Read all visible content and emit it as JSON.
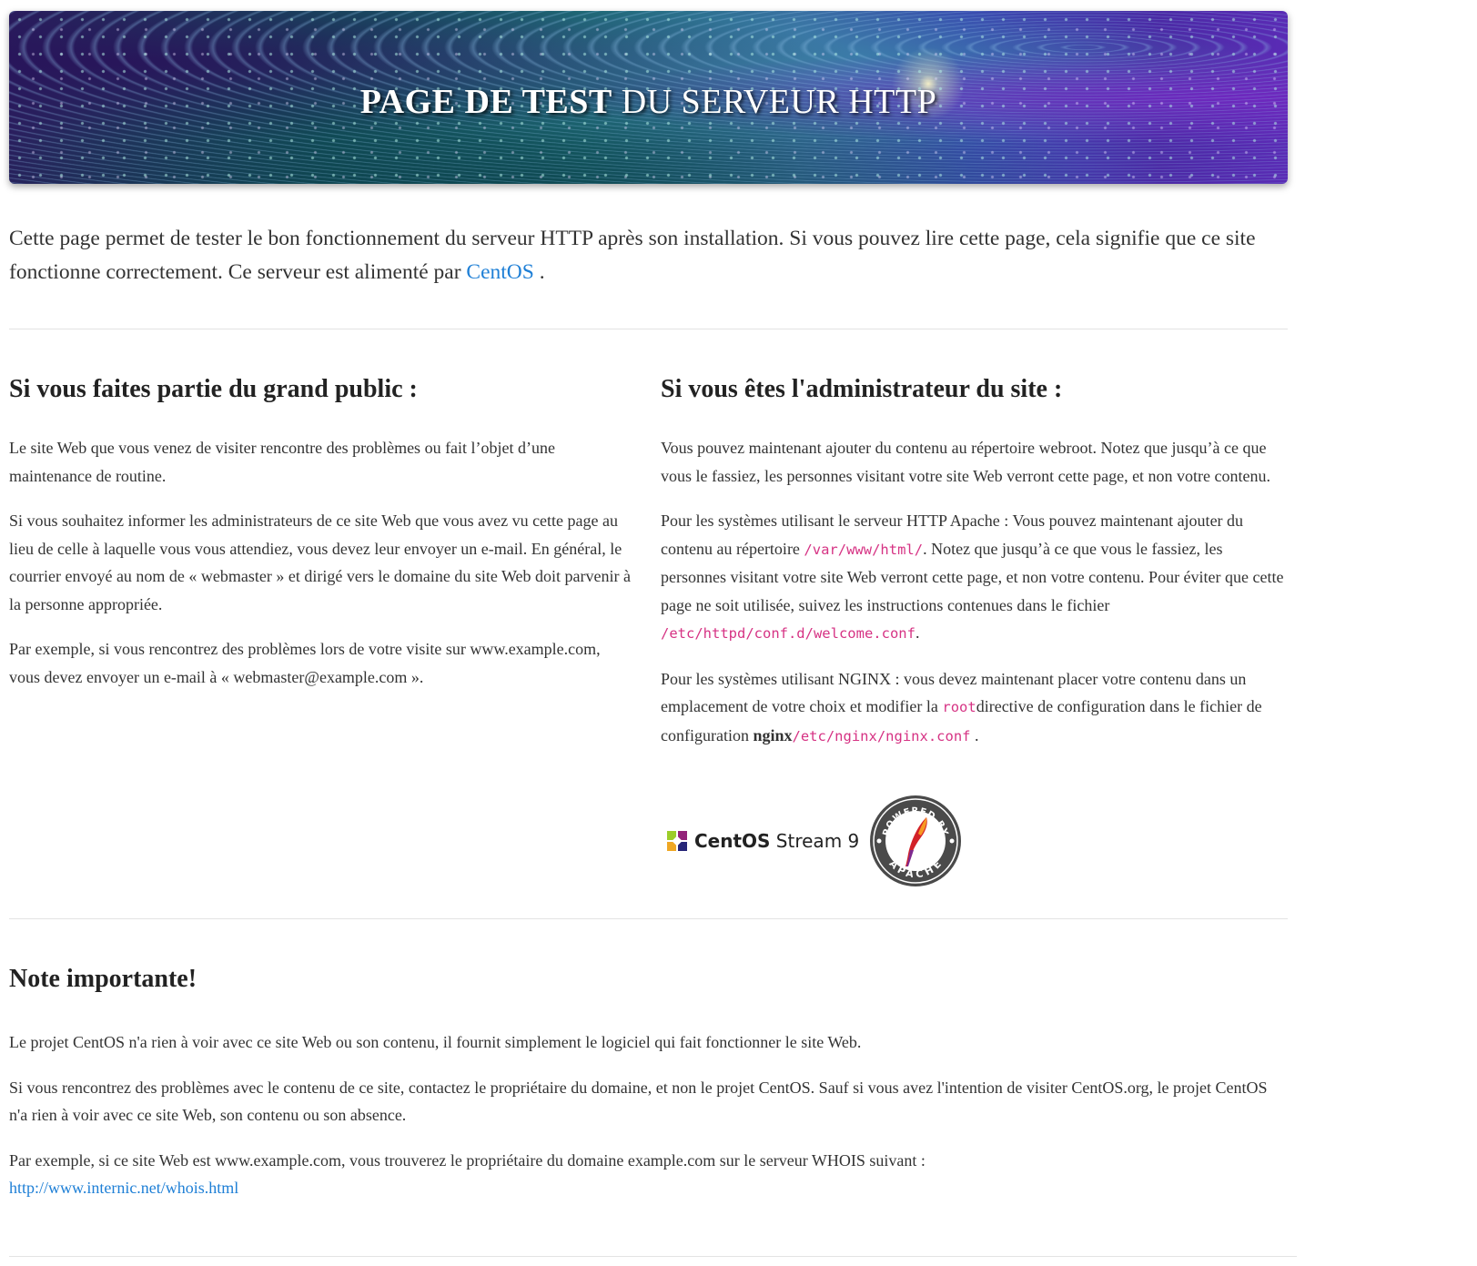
{
  "banner": {
    "title_bold": "PAGE DE TEST",
    "title_rest": "DU SERVEUR HTTP"
  },
  "intro": {
    "text": "Cette page permet de tester le bon fonctionnement du serveur HTTP après son installation. Si vous pouvez lire cette page, cela signifie que ce site fonctionne correctement. Ce serveur est alimenté par",
    "link": "CentOS",
    "after": " ."
  },
  "public": {
    "heading": "Si vous faites partie du grand public :",
    "p1": "Le site Web que vous venez de visiter rencontre des problèmes ou fait l’objet d’une maintenance de routine.",
    "p2": "Si vous souhaitez informer les administrateurs de ce site Web que vous avez vu cette page au lieu de celle à laquelle vous vous attendiez, vous devez leur envoyer un e-mail. En général, le courrier envoyé au nom de « webmaster » et dirigé vers le domaine du site Web doit parvenir à la personne appropriée.",
    "p3": "Par exemple, si vous rencontrez des problèmes lors de votre visite sur www.example.com, vous devez envoyer un e-mail à « webmaster@example.com »."
  },
  "admin": {
    "heading": "Si vous êtes l'administrateur du site :",
    "p1": "Vous pouvez maintenant ajouter du contenu au répertoire webroot. Notez que jusqu’à ce que vous le fassiez, les personnes visitant votre site Web verront cette page, et non votre contenu.",
    "p2_a": "Pour les systèmes utilisant le serveur HTTP Apache : Vous pouvez maintenant ajouter du contenu au répertoire ",
    "p2_code1": "/var/www/html/",
    "p2_b": ". Notez que jusqu’à ce que vous le fassiez, les personnes visitant votre site Web verront cette page, et non votre contenu. Pour éviter que cette page ne soit utilisée, suivez les instructions contenues dans le fichier ",
    "p2_code2": "/etc/httpd/conf.d/welcome.conf",
    "p2_c": ".",
    "p3_a": "Pour les systèmes utilisant NGINX : vous devez maintenant placer votre contenu dans un emplacement de votre choix et modifier la ",
    "p3_code1": "root",
    "p3_b": "directive de configuration dans le fichier de configuration ",
    "p3_bold": "nginx",
    "p3_code2": "/etc/nginx/nginx.conf",
    "p3_c": " ."
  },
  "logos": {
    "centos_bold": "CentOS",
    "centos_rest": " Stream 9",
    "apache_top": "POWERED BY",
    "apache_bottom": "APACHE"
  },
  "note": {
    "heading": "Note importante!",
    "p1": "Le projet CentOS n'a rien à voir avec ce site Web ou son contenu, il fournit simplement le logiciel qui fait fonctionner le site Web.",
    "p2": "Si vous rencontrez des problèmes avec le contenu de ce site, contactez le propriétaire du domaine, et non le projet CentOS. Sauf si vous avez l'intention de visiter CentOS.org, le projet CentOS n'a rien à voir avec ce site Web, son contenu ou son absence.",
    "p3": "Par exemple, si ce site Web est www.example.com, vous trouverez le propriétaire du domaine example.com sur le serveur WHOIS suivant :",
    "whois_link": "http://www.internic.net/whois.html"
  },
  "colors": {
    "link": "#1e7fd6",
    "code": "#d63384",
    "text": "#333333"
  }
}
